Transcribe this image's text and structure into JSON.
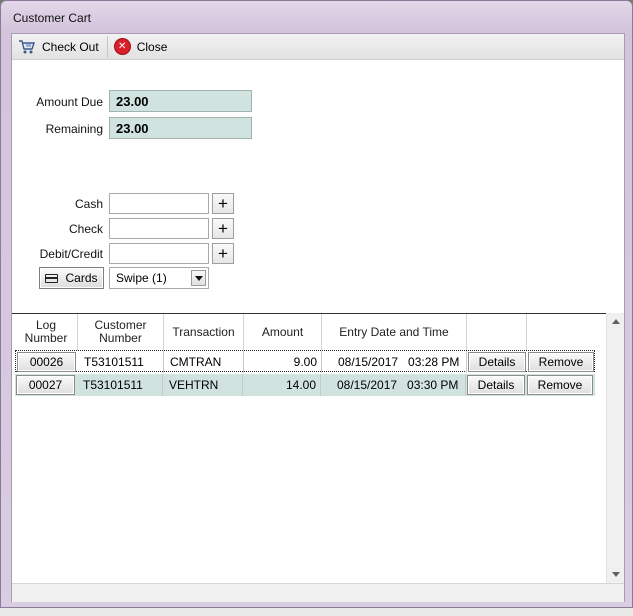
{
  "window": {
    "title": "Customer Cart"
  },
  "toolbar": {
    "checkout_label": "Check Out",
    "close_label": "Close"
  },
  "summary": {
    "amount_due_label": "Amount Due",
    "amount_due_value": "23.00",
    "remaining_label": "Remaining",
    "remaining_value": "23.00"
  },
  "payment": {
    "cash_label": "Cash",
    "cash_value": "",
    "check_label": "Check",
    "check_value": "",
    "debit_label": "Debit/Credit",
    "debit_value": "",
    "plus_symbol": "+",
    "cards_button_label": "Cards",
    "card_reader_selected": "Swipe (1)"
  },
  "grid": {
    "columns": [
      "Log\nNumber",
      "Customer\nNumber",
      "Transaction",
      "Amount",
      "Entry Date and Time"
    ],
    "rows": [
      {
        "log": "00026",
        "customer": "T53101511",
        "transaction": "CMTRAN",
        "amount": "9.00",
        "datetime": "08/15/2017   03:28 PM",
        "details": "Details",
        "remove": "Remove"
      },
      {
        "log": "00027",
        "customer": "T53101511",
        "transaction": "VEHTRN",
        "amount": "14.00",
        "datetime": "08/15/2017   03:30 PM",
        "details": "Details",
        "remove": "Remove"
      }
    ]
  },
  "colors": {
    "highlight": "#d1e3df",
    "close_icon": "#d9202a",
    "title_bar": "#d3c4dc"
  },
  "icons": {
    "checkout": "checkout-cart-icon",
    "close": "close-circle-icon",
    "card": "credit-card-icon"
  }
}
